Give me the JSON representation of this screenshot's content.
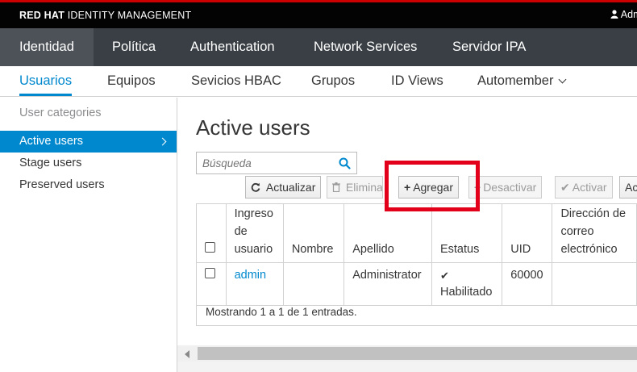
{
  "brand": {
    "bold": "RED HAT",
    "rest": " IDENTITY MANAGEMENT"
  },
  "user": {
    "icon": "user-icon",
    "label": "Adm"
  },
  "main_nav": [
    "Identidad",
    "Política",
    "Authentication",
    "Network Services",
    "Servidor IPA"
  ],
  "sub_nav": [
    "Usuarios",
    "Equipos",
    "Sevicios HBAC",
    "Grupos",
    "ID Views",
    "Automember"
  ],
  "sidebar": {
    "heading": "User categories",
    "items": [
      "Active users",
      "Stage users",
      "Preserved users"
    ]
  },
  "page": {
    "title": "Active users"
  },
  "search": {
    "placeholder": "Búsqueda",
    "icon": "search-icon"
  },
  "toolbar": {
    "refresh": "Actualizar",
    "delete": "Eliminar",
    "add": "Agregar",
    "disable": "Desactivar",
    "enable": "Activar",
    "actions": "Ac"
  },
  "table": {
    "headers": [
      "",
      "Ingreso de usuario",
      "Nombre",
      "Apellido",
      "Estatus",
      "UID",
      "Dirección de correo electrónico"
    ],
    "rows": [
      {
        "login": "admin",
        "first": "",
        "last": "Administrator",
        "status": "Habilitado",
        "uid": "60000",
        "email": ""
      }
    ],
    "footer": "Mostrando 1 a 1 de 1 entradas."
  },
  "colors": {
    "accent": "#0088ce",
    "highlight": "#e3001b",
    "nav": "#393f44"
  }
}
